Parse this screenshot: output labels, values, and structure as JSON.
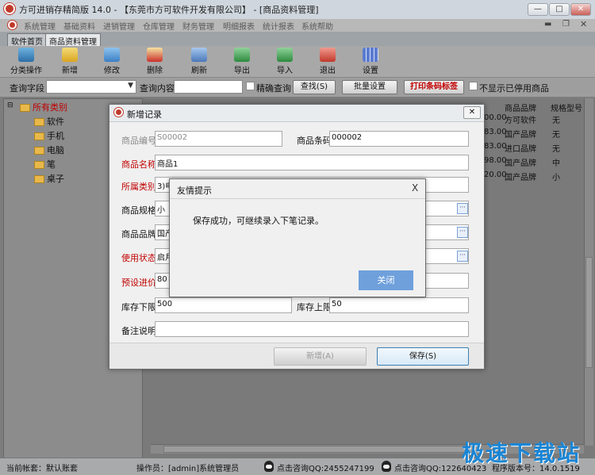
{
  "window": {
    "title": "方可进销存精简版 14.0 - 【东莞市方可软件开发有限公司】 - [商品资料管理]",
    "min": "—",
    "max": "□",
    "close": "✕"
  },
  "menu": [
    "系统管理",
    "基础资料",
    "进销管理",
    "仓库管理",
    "财务管理",
    "明细报表",
    "统计报表",
    "系统帮助"
  ],
  "tabs": [
    "软件首页",
    "商品资料管理"
  ],
  "toolbar": [
    "分类操作",
    "新增",
    "修改",
    "删除",
    "刷新",
    "导出",
    "导入",
    "退出",
    "设置"
  ],
  "search": {
    "field_label": "查询字段",
    "content_label": "查询内容",
    "exact_label": "精确查询",
    "find_button": "查找(S)",
    "batch_button": "批量设置",
    "print_button": "打印条码标签",
    "hide_label": "不显示已停用商品"
  },
  "tree": {
    "root": "所有类别",
    "children": [
      "软件",
      "手机",
      "电脑",
      "笔",
      "桌子"
    ]
  },
  "grid": {
    "headers": [
      "商品品牌",
      "规格型号"
    ],
    "rows": [
      {
        "price": "00.00",
        "brand": "方可软件",
        "spec": "无"
      },
      {
        "price": "83.00",
        "brand": "国产品牌",
        "spec": "无"
      },
      {
        "price": "83.00",
        "brand": "进口品牌",
        "spec": "无"
      },
      {
        "price": "98.00",
        "brand": "国产品牌",
        "spec": "中"
      },
      {
        "price": "20.00",
        "brand": "国产品牌",
        "spec": "小"
      }
    ]
  },
  "dialog": {
    "title": "新增记录",
    "close": "✕",
    "fields": {
      "code_label": "商品编号",
      "code_value": "S00002",
      "barcode_label": "商品条码",
      "barcode_value": "000002",
      "name_label": "商品名称",
      "name_value": "商品1",
      "category_label": "所属类别",
      "category_value": "3)电",
      "spec_label": "商品规格",
      "spec_value": "小",
      "brand_label": "商品品牌",
      "brand_value": "国产",
      "status_label": "使用状态",
      "status_value": "启月",
      "price_label": "预设进价",
      "price_value": "80",
      "min_label": "库存下限",
      "min_value": "500",
      "max_label": "库存上限",
      "max_value": "50",
      "note_label": "备注说明",
      "note_value": ""
    },
    "add_button": "新增(A)",
    "save_button": "保存(S)",
    "dots": "···"
  },
  "message": {
    "title": "友情提示",
    "close": "X",
    "text": "保存成功，可继续录入下笔记录。",
    "button": "关闭"
  },
  "status": {
    "account": "当前帐套：默认账套",
    "operator": "操作员：[admin]系统管理员",
    "qq1": "点击咨询QQ:2455247199",
    "qq2": "点击咨询QQ:1226404238",
    "version": "程序版本号：14.0.1519"
  },
  "watermark": "极速下载站",
  "colors": {
    "accent": "#6fa0dc",
    "required": "#c00000"
  }
}
